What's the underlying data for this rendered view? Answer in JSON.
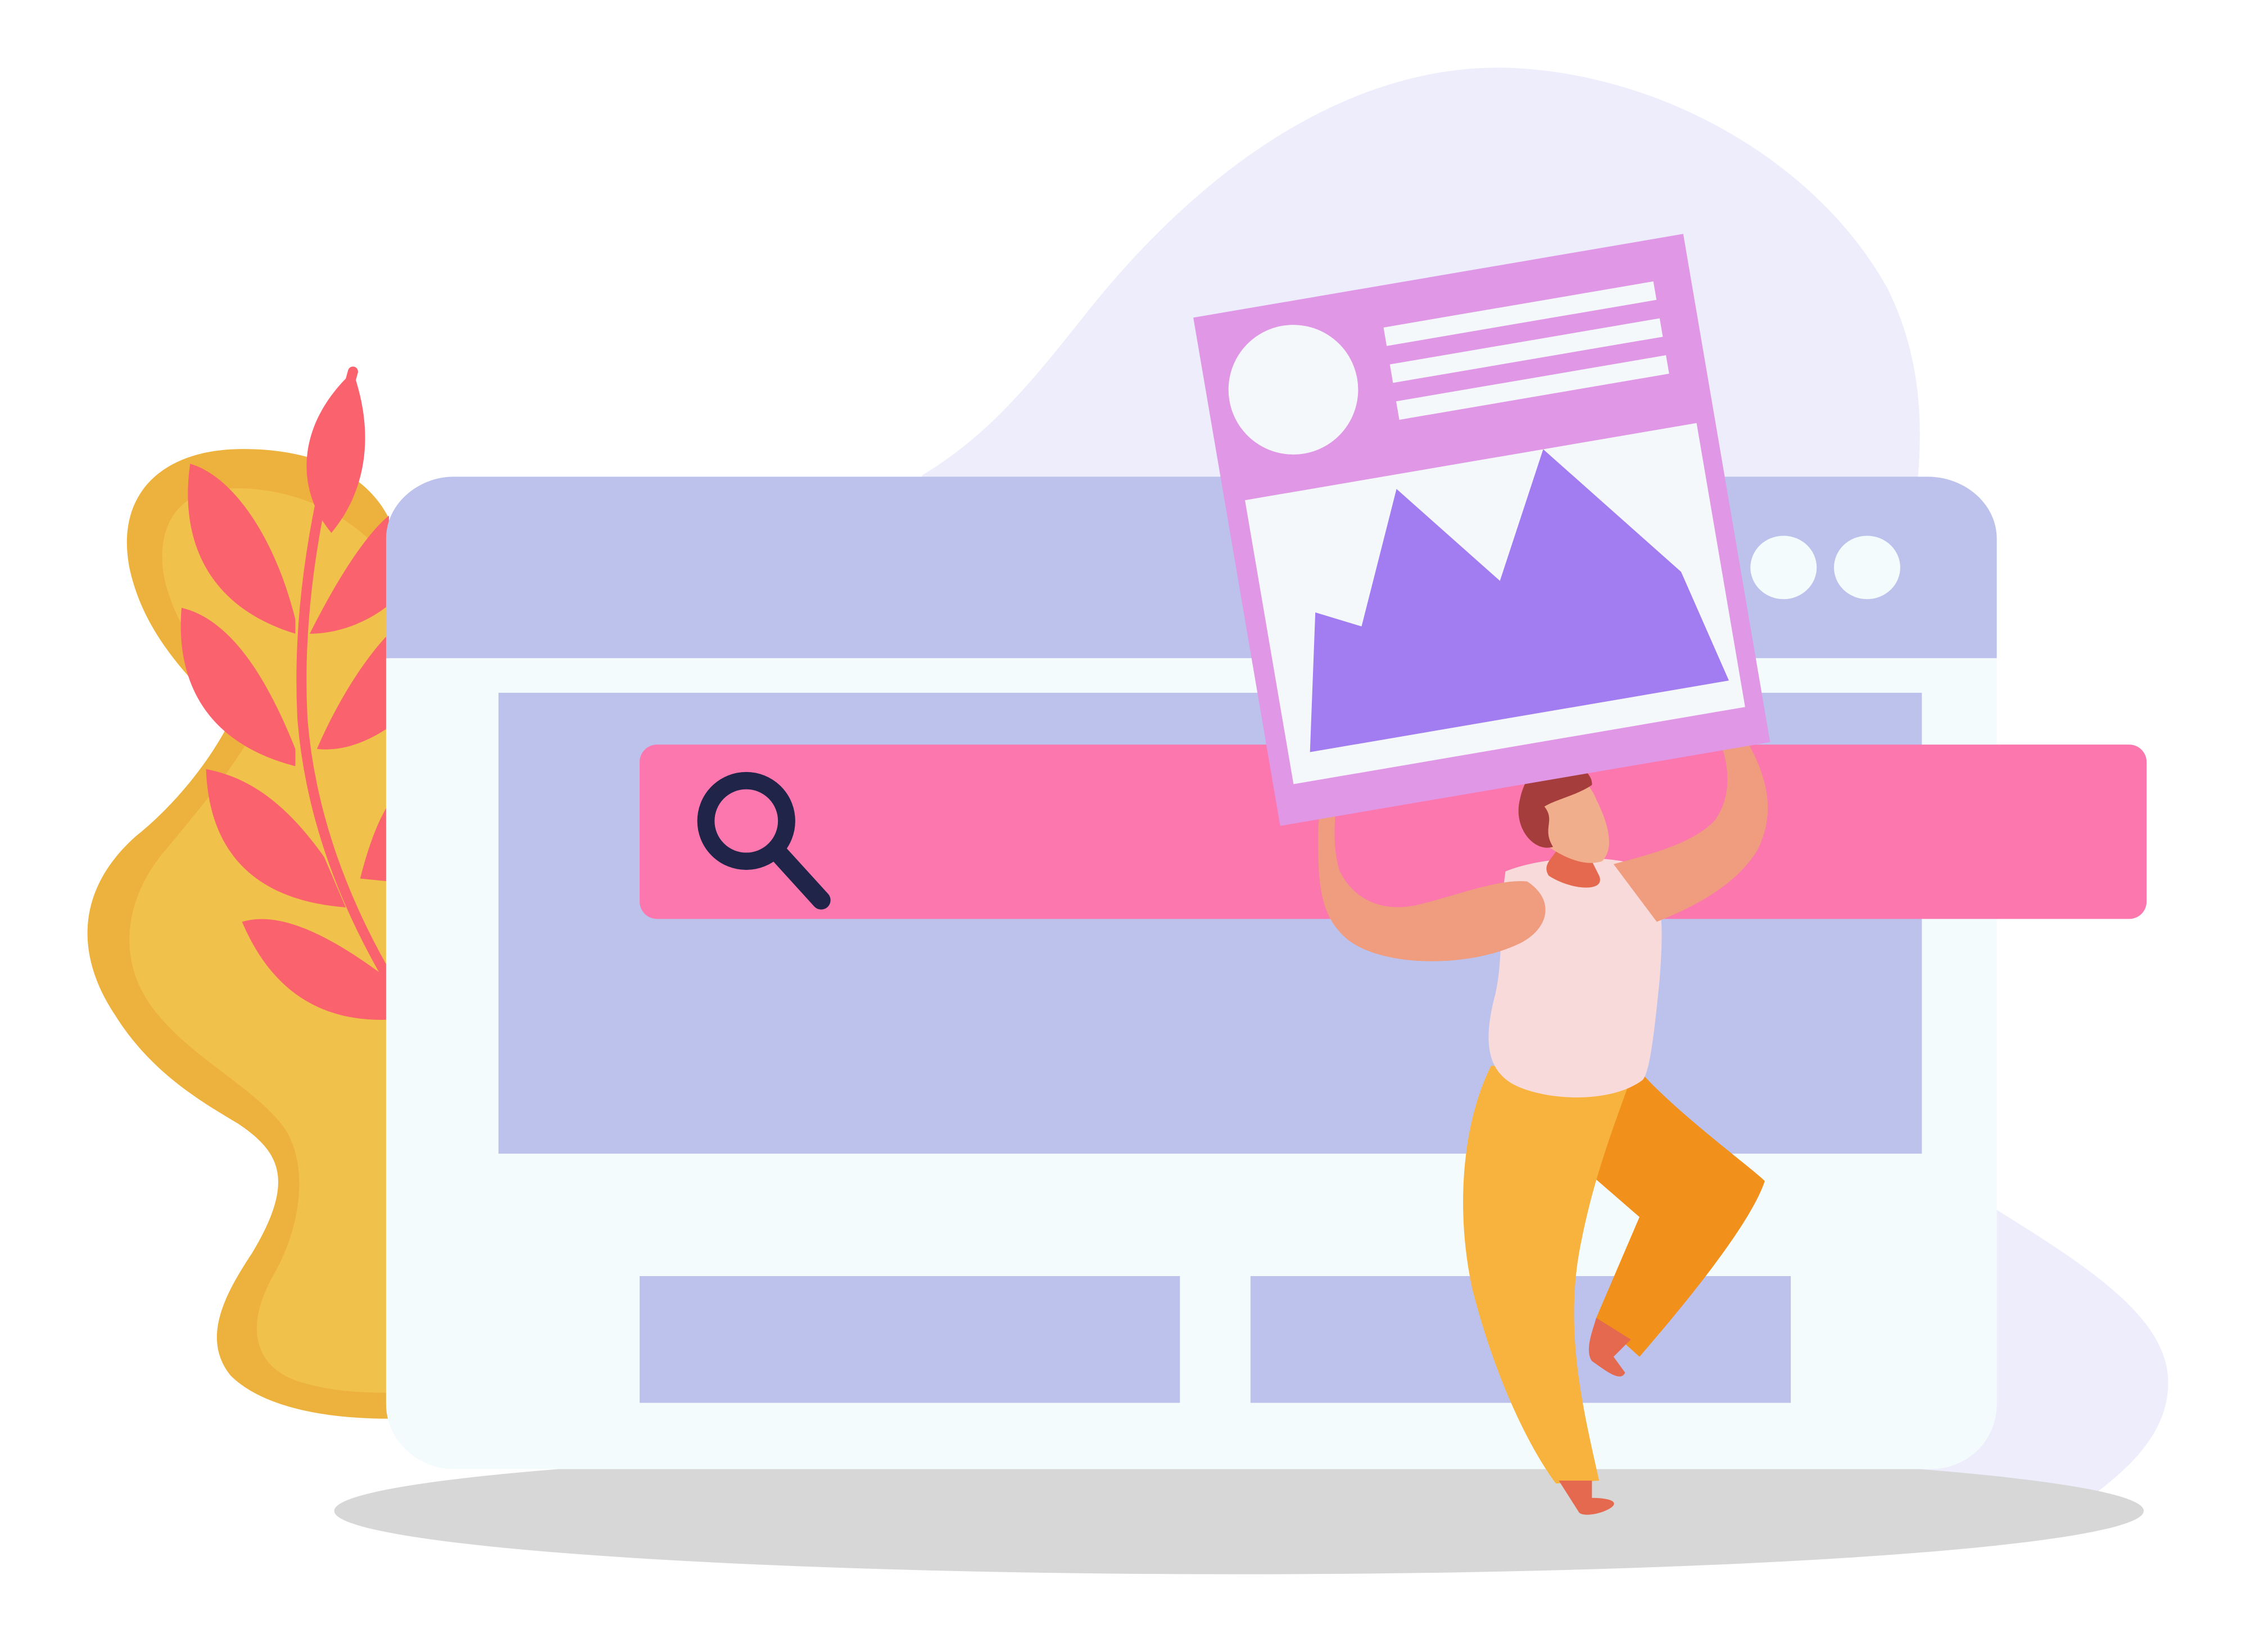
{
  "illustration": {
    "kind": "flat vector illustration",
    "colors": {
      "background_blob": "#EDEDFC",
      "window_frame": "#BCC2EC",
      "window_body": "#F4FBFC",
      "search_bar": "#FB77AE",
      "search_icon": "#1F2448",
      "image_card": "#E097E6",
      "image_card_panel": "#F4F8FB",
      "mountains": "#A27DF1",
      "plant_dark": "#EDB23D",
      "plant_light": "#F1C24B",
      "leaves": "#FA626D",
      "shadow": "#D7D7D7",
      "skin": "#EF9C7F",
      "face": "#F1AE8D",
      "hair": "#A63D3D",
      "shirt": "#F9DADB",
      "pants_front": "#F8B33E",
      "pants_back": "#F2901C",
      "shoes": "#E5694F"
    },
    "icons": [
      "search-icon",
      "image-placeholder-icon",
      "mountain-icon",
      "window-dots-icon"
    ]
  }
}
